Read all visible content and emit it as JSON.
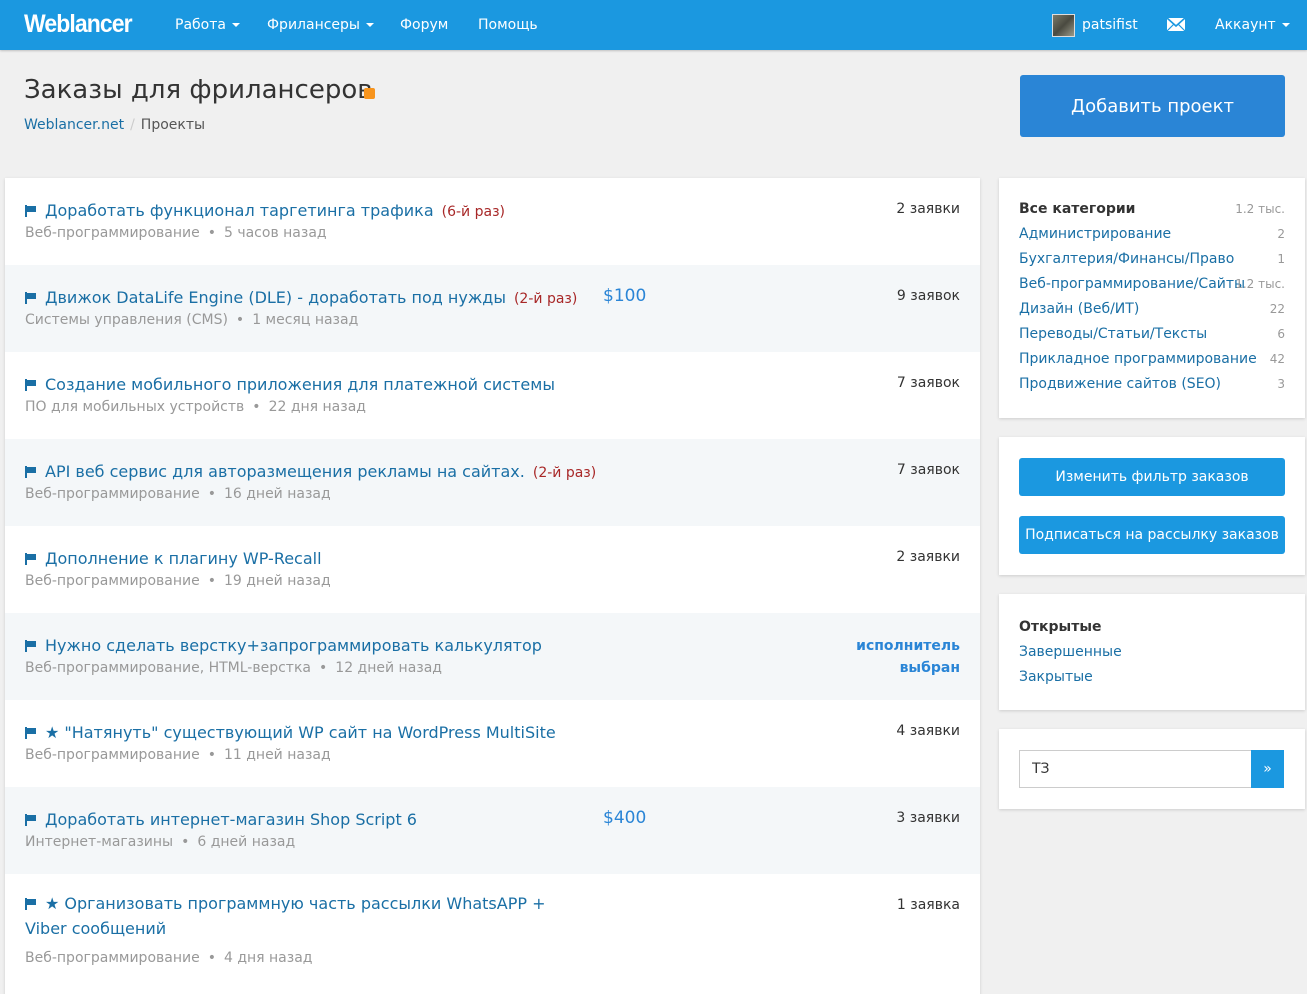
{
  "header": {
    "logo": "Weblancer",
    "nav": [
      {
        "label": "Работа"
      },
      {
        "label": "Фрилансеры"
      },
      {
        "label": "Форум"
      },
      {
        "label": "Помощь"
      }
    ],
    "username": "patsifist",
    "account_label": "Аккаунт"
  },
  "page": {
    "title": "Заказы для фрилансеров",
    "breadcrumb": [
      "Weblancer.net",
      "Проекты"
    ],
    "add_project_label": "Добавить проект"
  },
  "projects": [
    {
      "title": "Доработать функционал таргетинга трафика",
      "repeat": "(6-й раз)",
      "category": "Веб-программирование",
      "time": "5 часов назад",
      "bids": "2 заявки"
    },
    {
      "title": "Движок DataLife Engine (DLE) - доработать под нужды",
      "repeat": "(2-й раз)",
      "price": "$100",
      "category": "Системы управления (CMS)",
      "time": "1 месяц назад",
      "bids": "9 заявок"
    },
    {
      "title": "Создание мобильного приложения для платежной системы",
      "category": "ПО для мобильных устройств",
      "time": "22 дня назад",
      "bids": "7 заявок"
    },
    {
      "title": "API веб сервис для авторазмещения рекламы на сайтах.",
      "repeat": "(2-й раз)",
      "category": "Веб-программирование",
      "time": "16 дней назад",
      "bids": "7 заявок"
    },
    {
      "title": "Дополнение к плагину WP-Recall",
      "category": "Веб-программирование",
      "time": "19 дней назад",
      "bids": "2 заявки"
    },
    {
      "title": "Нужно сделать верстку+запрограммировать калькулятор",
      "category": "Веб-программирование, HTML-верстка",
      "time": "12 дней назад",
      "status_line1": "исполнитель",
      "status_line2": "выбран"
    },
    {
      "title": "\"Натянуть\" существующий WP сайт на WordPress MultiSite",
      "star": "★",
      "category": "Веб-программирование",
      "time": "11 дней назад",
      "bids": "4 заявки"
    },
    {
      "title": "Доработать интернет-магазин Shop Script 6",
      "price": "$400",
      "category": "Интернет-магазины",
      "time": "6 дней назад",
      "bids": "3 заявки"
    },
    {
      "title": "Организовать программную часть рассылки WhatsAPP + Viber сообщений",
      "star": "★",
      "category": "Веб-программирование",
      "time": "4 дня назад",
      "bids": "1 заявка"
    }
  ],
  "categories": [
    {
      "label": "Все категории",
      "count": "1.2 тыс."
    },
    {
      "label": "Администрирование",
      "count": "2"
    },
    {
      "label": "Бухгалтерия/Финансы/Право",
      "count": "1"
    },
    {
      "label": "Веб-программирование/Сайты",
      "count": "1.2 тыс."
    },
    {
      "label": "Дизайн (Веб/ИТ)",
      "count": "22"
    },
    {
      "label": "Переводы/Статьи/Тексты",
      "count": "6"
    },
    {
      "label": "Прикладное программирование",
      "count": "42"
    },
    {
      "label": "Продвижение сайтов (SEO)",
      "count": "3"
    }
  ],
  "actions": {
    "change_filter": "Изменить фильтр заказов",
    "subscribe": "Подписаться на рассылку заказов"
  },
  "status_filter": [
    "Открытые",
    "Завершенные",
    "Закрытые"
  ],
  "search": {
    "value": "ТЗ",
    "button": "»"
  }
}
